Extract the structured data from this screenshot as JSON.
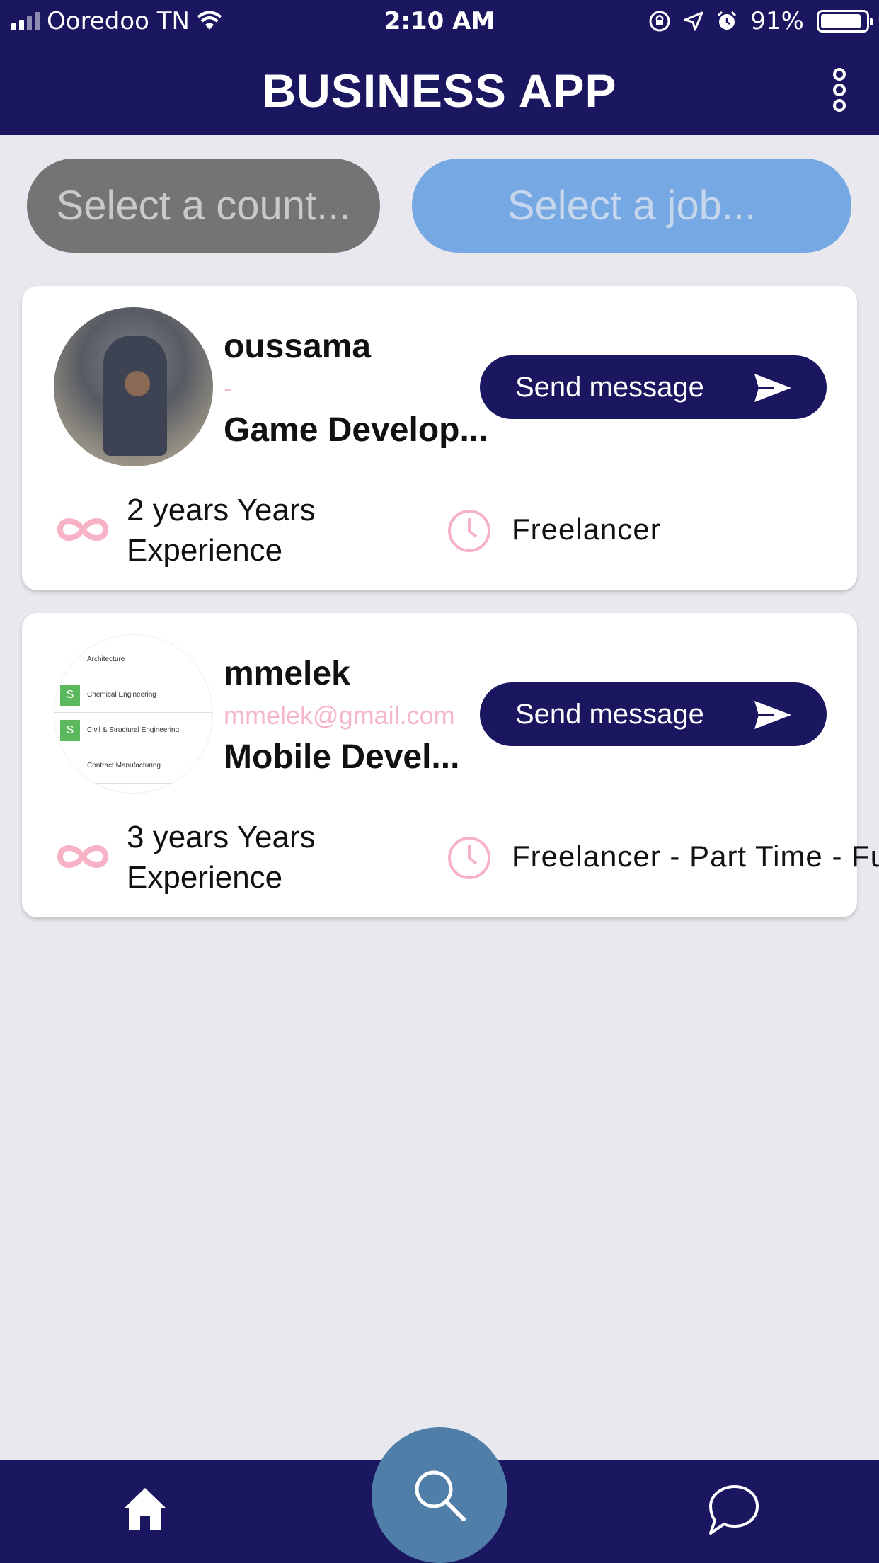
{
  "status_bar": {
    "carrier": "Ooredoo TN",
    "time": "2:10 AM",
    "battery": "91%",
    "battery_level": 0.91
  },
  "header": {
    "title": "BUSINESS APP",
    "menu_icon": "more-vertical-icon"
  },
  "filters": {
    "country_placeholder": "Select a count...",
    "job_placeholder": "Select a job..."
  },
  "profiles": [
    {
      "name": "oussama",
      "email": "-",
      "role": "Game Develop...",
      "button_label": "Send message",
      "experience": "2 years Years Experience",
      "work_type": "Freelancer"
    },
    {
      "name": "mmelek",
      "email": "mmelek@gmail.com",
      "role": "Mobile Devel...",
      "button_label": "Send message",
      "experience": "3 years Years Experience",
      "work_type": "Freelancer - Part Time - Fu",
      "avatar_items": [
        "Architecture",
        "Chemical Engineering",
        "Civil & Structural Engineering",
        "Contract Manufacturing"
      ]
    }
  ],
  "bottom_nav": {
    "items": [
      "home-icon",
      "search-icon",
      "chat-icon"
    ]
  },
  "colors": {
    "primary": "#1b1660",
    "accent_pink": "#f5b6c8",
    "search_fab": "#4f7fa8",
    "country_filter": "#747474",
    "job_filter": "#76a9e3"
  }
}
